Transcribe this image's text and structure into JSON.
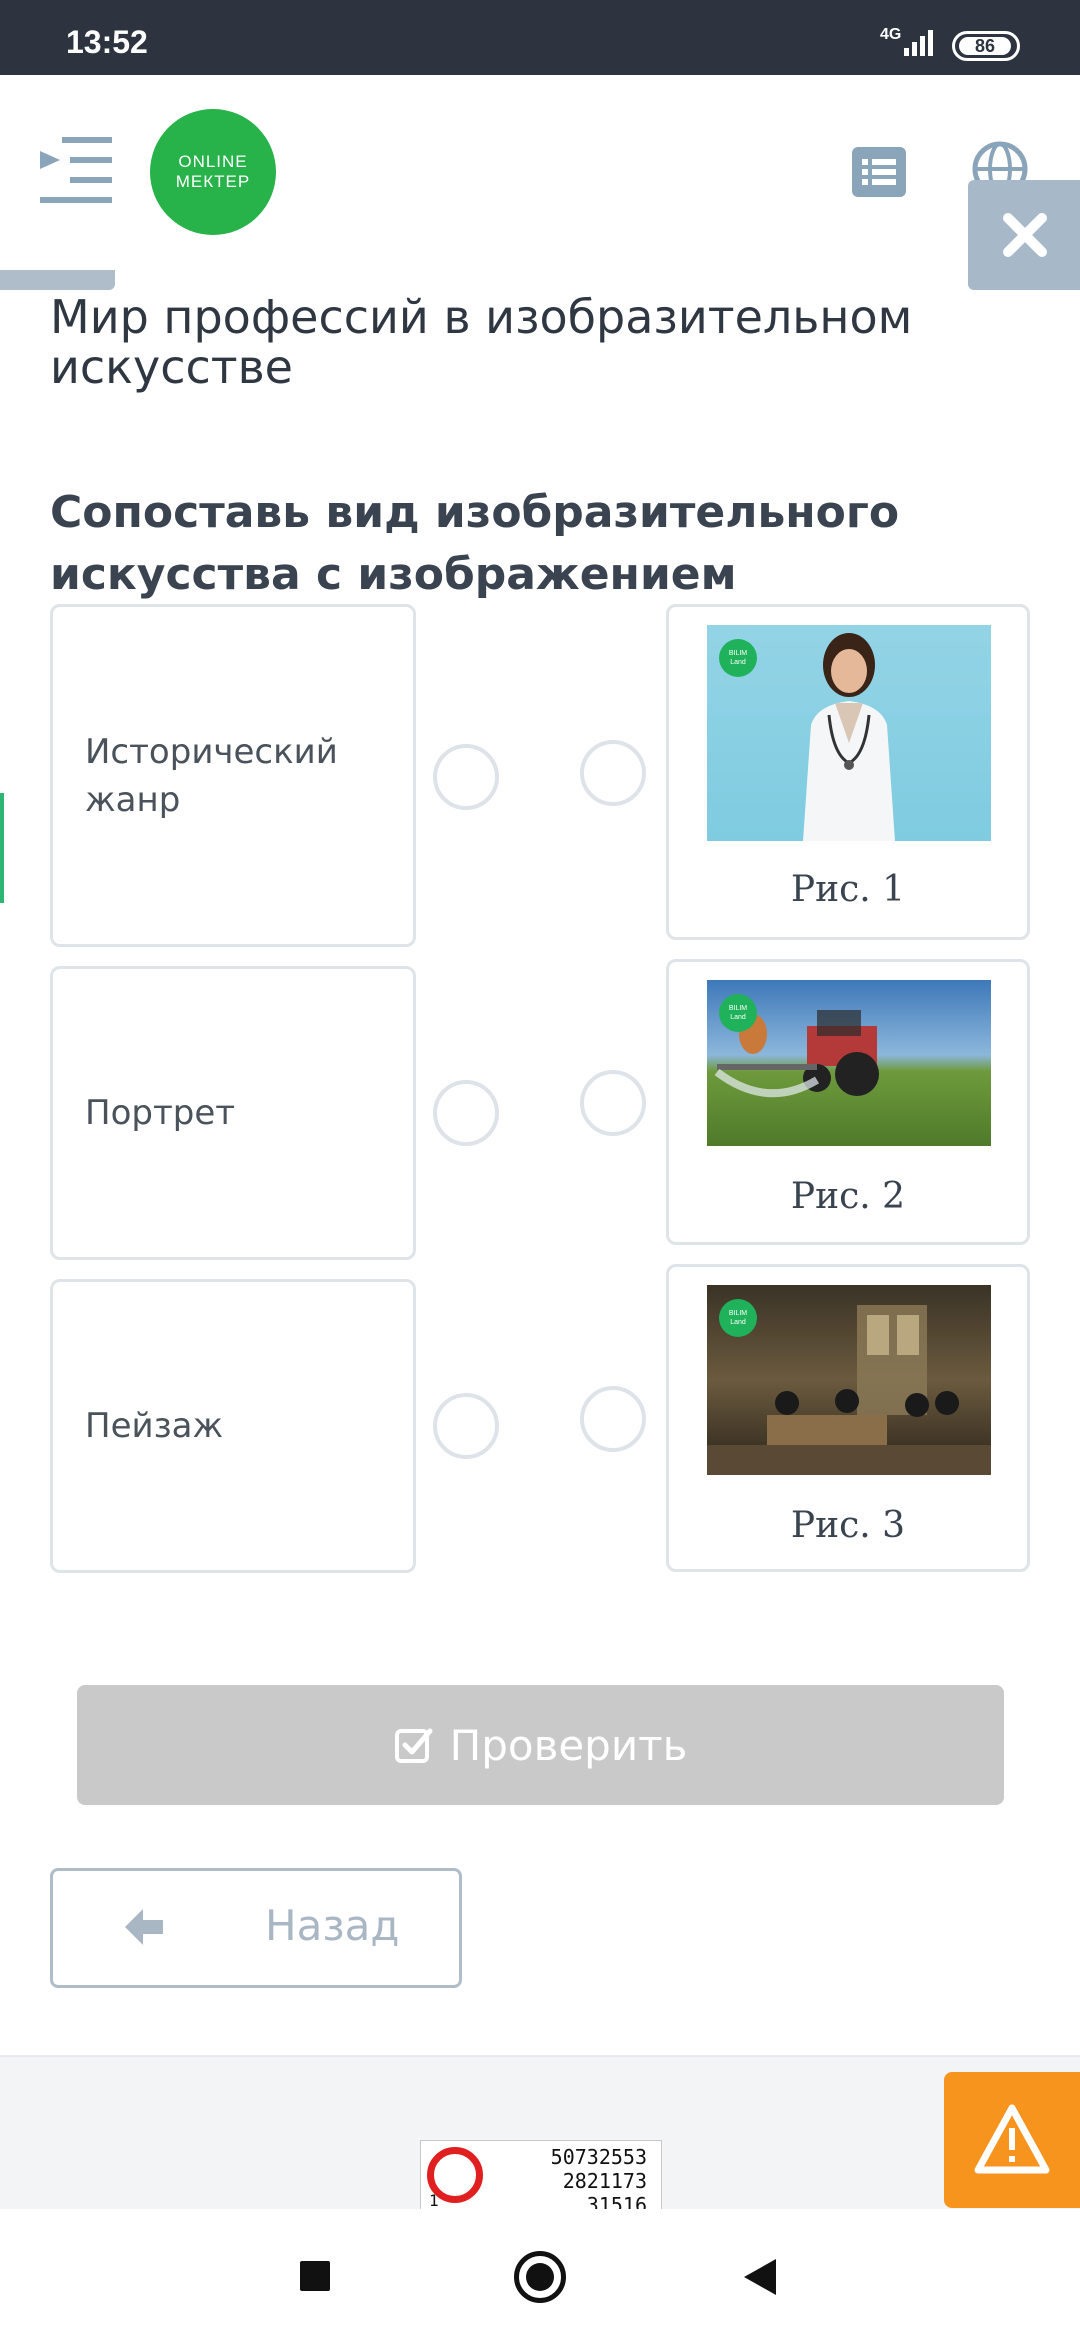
{
  "status_bar": {
    "time": "13:52",
    "network": "4G",
    "battery": "86"
  },
  "header": {
    "logo_line1": "ONLINE",
    "logo_line2": "МЕКТЕР"
  },
  "page_title": "Мир профессий в изобразительном искусстве",
  "task": "Сопоставь вид изобразительного искусства с изображением профессии.",
  "left_items": [
    {
      "label": "Исторический жанр"
    },
    {
      "label": "Портрет"
    },
    {
      "label": "Пейзаж"
    }
  ],
  "right_items": [
    {
      "caption": "Рис. 1",
      "image": "doctor-photo"
    },
    {
      "caption": "Рис. 2",
      "image": "tractor-field-photo"
    },
    {
      "caption": "Рис. 3",
      "image": "historical-interior-painting"
    }
  ],
  "image_badge": {
    "line1": "BILIM",
    "line2": "Land"
  },
  "buttons": {
    "check": "Проверить",
    "back": "Назад"
  },
  "stat_widget": {
    "values": [
      "50732553",
      "2821173",
      "31516"
    ],
    "row_label": "1"
  },
  "colors": {
    "status_bar": "#2d3440",
    "logo_green": "#27b24a",
    "close_button": "#a7b9c9",
    "check_disabled": "#c9c9c9",
    "warning": "#f7941d"
  },
  "icons": [
    "menu-icon",
    "list-icon",
    "globe-icon",
    "close-icon",
    "check-square-icon",
    "arrow-left-icon",
    "warning-icon"
  ]
}
